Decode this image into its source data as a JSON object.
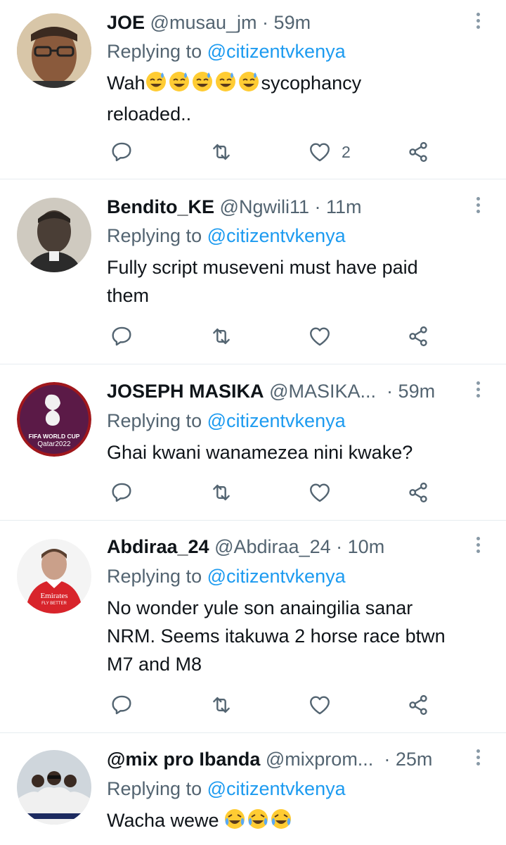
{
  "tweets": [
    {
      "name": "JOE",
      "handle": "@musau_jm",
      "time": "59m",
      "replying_prefix": "Replying to",
      "replying_to": "@citizentvkenya",
      "text_lines": [
        "Wah",
        "sycophancy",
        "reloaded.."
      ],
      "likes": "2",
      "avatar_icon": "portrait-glasses-avatar"
    },
    {
      "name": "Bendito_KE",
      "handle": "@Ngwili11",
      "time": "11m",
      "replying_prefix": "Replying to",
      "replying_to": "@citizentvkenya",
      "text_lines": [
        "Fully script museveni must have paid",
        "them"
      ],
      "likes": "",
      "avatar_icon": "portrait-sepia-avatar"
    },
    {
      "name": "JOSEPH MASIKA",
      "handle": "@MASIKA...",
      "time": "59m",
      "replying_prefix": "Replying to",
      "replying_to": "@citizentvkenya",
      "text_lines": [
        "Ghai kwani wanamezea nini kwake?"
      ],
      "likes": "",
      "avatar_text": [
        "FIFA WORLD CUP",
        "Qatar2022"
      ]
    },
    {
      "name": "Abdiraa_24",
      "handle": "@Abdiraa_24",
      "time": "10m",
      "replying_prefix": "Replying to",
      "replying_to": "@citizentvkenya",
      "text_lines": [
        "No wonder yule son anaingilia sanar",
        "NRM. Seems itakuwa 2 horse race btwn",
        "M7 and M8"
      ],
      "likes": "",
      "avatar_text": [
        "Emirates",
        "FLY BETTER"
      ]
    },
    {
      "name": "@mix pro Ibanda",
      "handle": "@mixprom...",
      "time": "25m",
      "replying_prefix": "Replying to",
      "replying_to": "@citizentvkenya",
      "text_lines": [
        "Wacha wewe"
      ],
      "likes": "",
      "avatar_icon": "group-photo-avatar"
    }
  ],
  "colors": {
    "link": "#1d9bf0",
    "muted": "#536471",
    "divider": "#e6ecf0"
  },
  "icons": [
    "reply-icon",
    "retweet-icon",
    "like-icon",
    "share-icon",
    "more-icon"
  ]
}
